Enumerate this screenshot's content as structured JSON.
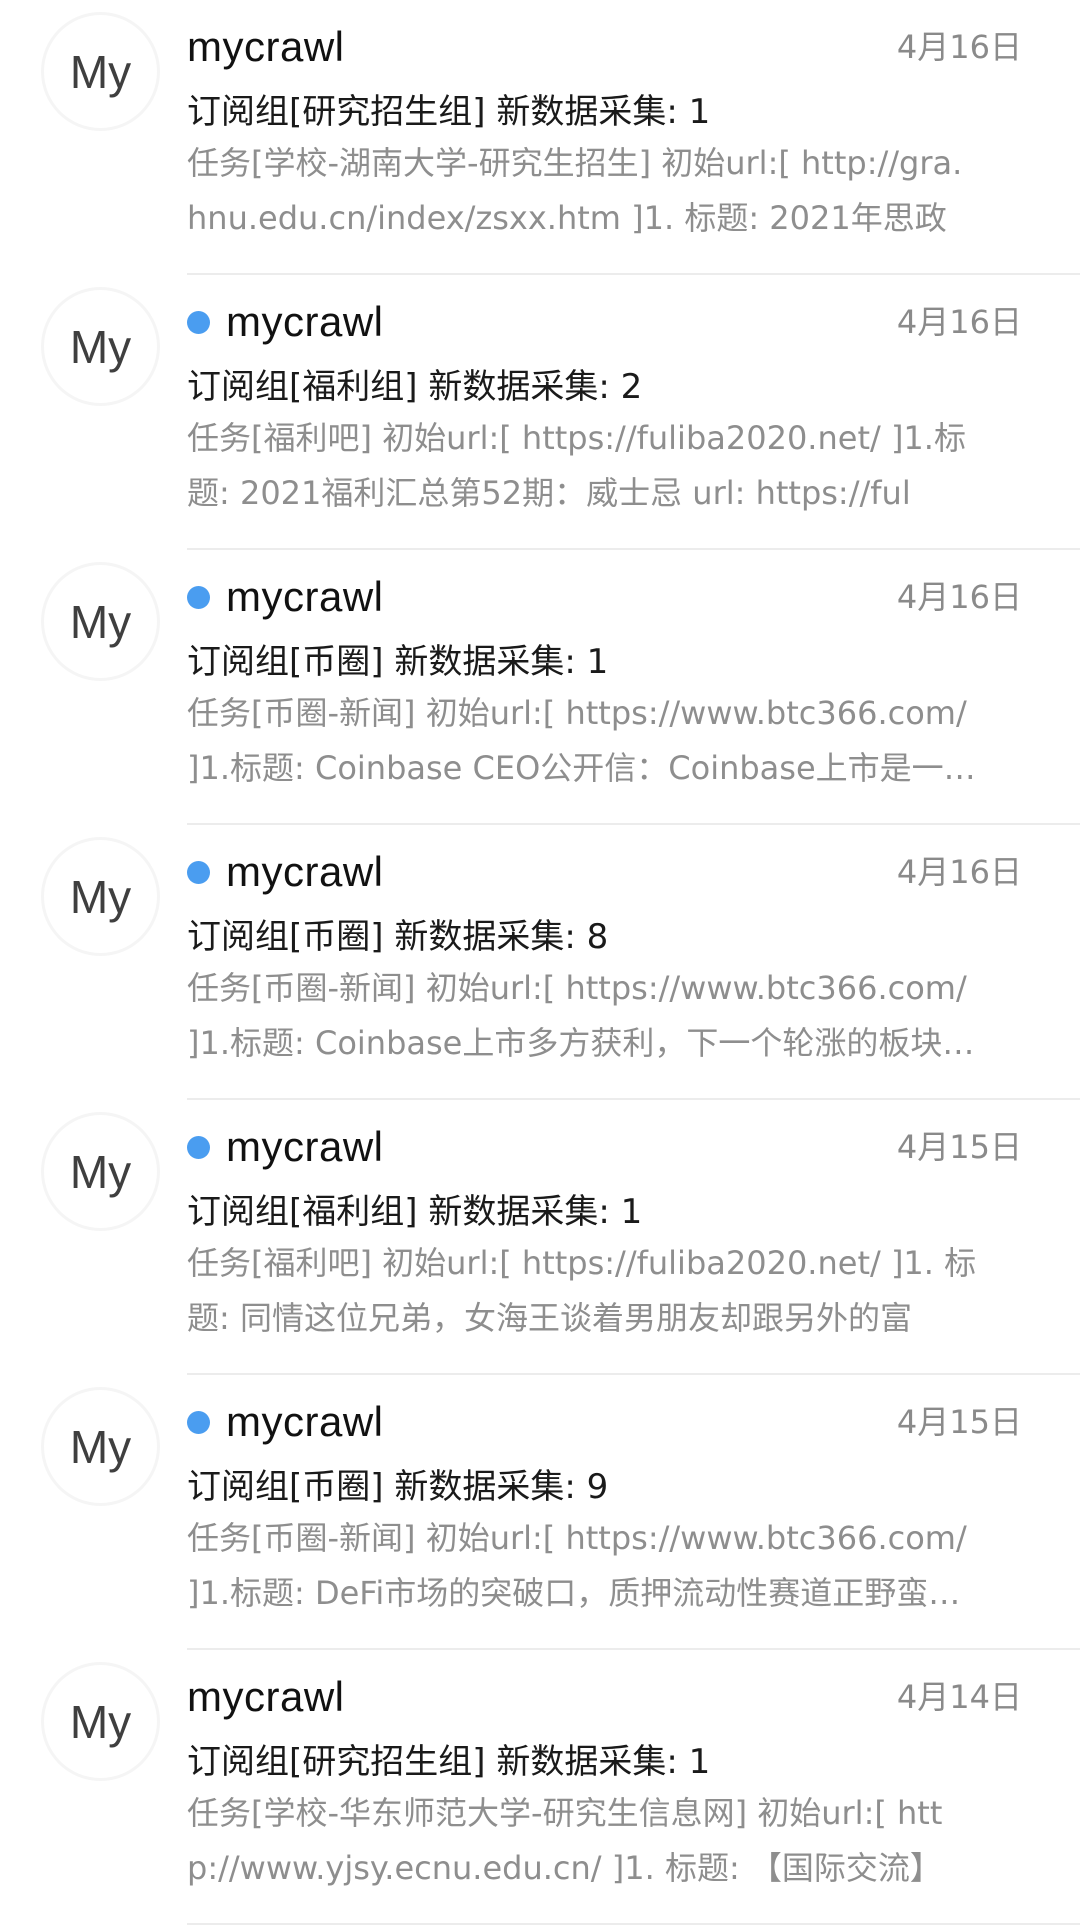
{
  "colors": {
    "unread_dot": "#4a9df0",
    "sender": "#111111",
    "subject": "#1a1a1a",
    "preview": "#8e8e8e",
    "date": "#8a8a8a",
    "divider": "#ececec"
  },
  "messages": [
    {
      "avatar": "My",
      "unread": false,
      "sender": "mycrawl",
      "date": "4月16日",
      "subject": "订阅组[研究招生组] 新数据采集: 1",
      "preview": [
        "任务[学校-湖南大学-研究生招生] 初始url:[ http://gra.",
        "hnu.edu.cn/index/zsxx.htm ]1. 标题: 2021年思政"
      ]
    },
    {
      "avatar": "My",
      "unread": true,
      "sender": "mycrawl",
      "date": "4月16日",
      "subject": "订阅组[福利组] 新数据采集: 2",
      "preview": [
        "任务[福利吧] 初始url:[ https://fuliba2020.net/ ]1.标",
        "题: 2021福利汇总第52期：威士忌 url: https://ful"
      ]
    },
    {
      "avatar": "My",
      "unread": true,
      "sender": "mycrawl",
      "date": "4月16日",
      "subject": "订阅组[币圈] 新数据采集: 1",
      "preview": [
        "任务[币圈-新闻] 初始url:[ https://www.btc366.com/",
        "]1.标题: Coinbase CEO公开信：Coinbase上市是一…"
      ]
    },
    {
      "avatar": "My",
      "unread": true,
      "sender": "mycrawl",
      "date": "4月16日",
      "subject": "订阅组[币圈] 新数据采集: 8",
      "preview": [
        "任务[币圈-新闻] 初始url:[ https://www.btc366.com/",
        "]1.标题: Coinbase上市多方获利，下一个轮涨的板块…"
      ]
    },
    {
      "avatar": "My",
      "unread": true,
      "sender": "mycrawl",
      "date": "4月15日",
      "subject": "订阅组[福利组] 新数据采集: 1",
      "preview": [
        "任务[福利吧] 初始url:[ https://fuliba2020.net/ ]1. 标",
        "题: 同情这位兄弟，女海王谈着男朋友却跟另外的富"
      ]
    },
    {
      "avatar": "My",
      "unread": true,
      "sender": "mycrawl",
      "date": "4月15日",
      "subject": "订阅组[币圈] 新数据采集: 9",
      "preview": [
        "任务[币圈-新闻] 初始url:[ https://www.btc366.com/",
        "]1.标题: DeFi市场的突破口，质押流动性赛道正野蛮…"
      ]
    },
    {
      "avatar": "My",
      "unread": false,
      "sender": "mycrawl",
      "date": "4月14日",
      "subject": "订阅组[研究招生组] 新数据采集: 1",
      "preview": [
        "任务[学校-华东师范大学-研究生信息网] 初始url:[ htt",
        "p://www.yjsy.ecnu.edu.cn/ ]1. 标题: 【国际交流】"
      ]
    }
  ]
}
